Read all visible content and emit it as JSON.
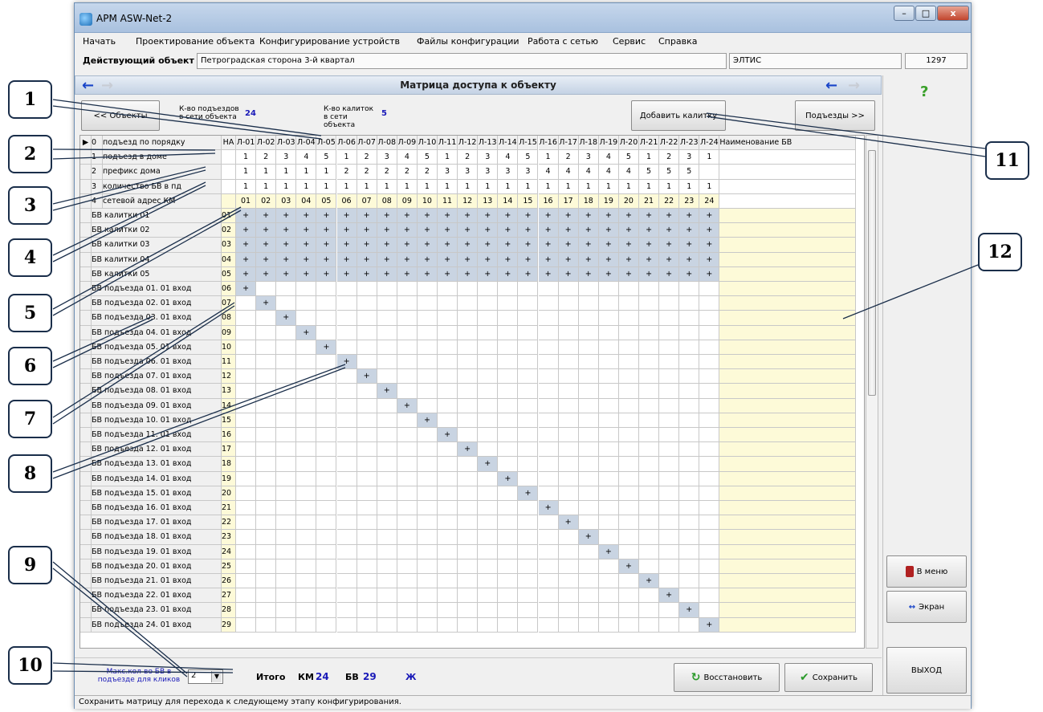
{
  "window": {
    "title": "АРМ ASW-Net-2",
    "btn_min": "–",
    "btn_max": "□",
    "btn_close": "x"
  },
  "menu": [
    "Начать",
    "Проектирование объекта",
    "Конфигурирование устройств",
    "Файлы конфигурации",
    "Работа с сетью",
    "Сервис",
    "Справка"
  ],
  "objectbar": {
    "label": "Действующий объект",
    "name": "Петроградская сторона 3-й квартал",
    "company": "ЭЛТИС",
    "code": "1297"
  },
  "header": {
    "title": "Матрица доступа к объекту"
  },
  "toolbar": {
    "back_button": "<< Объекты",
    "entrances_label": "К-во подъездов в сети объекта",
    "entrances_value": "24",
    "gates_label": "К-во калиток в сети объекта",
    "gates_value": "5",
    "add_gate_button": "Добавить калитку",
    "entrances_button": "Подъезды >>"
  },
  "grid": {
    "corner": "НА",
    "row_headers": [
      {
        "num": "0",
        "label": "подъезд по порядку"
      },
      {
        "num": "1",
        "label": "подъезд в доме"
      },
      {
        "num": "2",
        "label": "префикс дома"
      },
      {
        "num": "3",
        "label": "количество БВ в пд"
      },
      {
        "num": "4",
        "label": "сетевой адрес КМ"
      }
    ],
    "columns": [
      "Л-01",
      "Л-02",
      "Л-03",
      "Л-04",
      "Л-05",
      "Л-06",
      "Л-07",
      "Л-08",
      "Л-09",
      "Л-10",
      "Л-11",
      "Л-12",
      "Л-13",
      "Л-14",
      "Л-15",
      "Л-16",
      "Л-17",
      "Л-18",
      "Л-19",
      "Л-20",
      "Л-21",
      "Л-22",
      "Л-23",
      "Л-24"
    ],
    "name_column": "Наименование БВ",
    "entrance_in_house": [
      "1",
      "2",
      "3",
      "4",
      "5",
      "1",
      "2",
      "3",
      "4",
      "5",
      "1",
      "2",
      "3",
      "4",
      "5",
      "1",
      "2",
      "3",
      "4",
      "5",
      "1",
      "2",
      "3",
      "1"
    ],
    "house_prefix": [
      "1",
      "1",
      "1",
      "1",
      "1",
      "2",
      "2",
      "2",
      "2",
      "2",
      "3",
      "3",
      "3",
      "3",
      "3",
      "4",
      "4",
      "4",
      "4",
      "4",
      "5",
      "5",
      "5",
      ""
    ],
    "bv_count": [
      "1",
      "1",
      "1",
      "1",
      "1",
      "1",
      "1",
      "1",
      "1",
      "1",
      "1",
      "1",
      "1",
      "1",
      "1",
      "1",
      "1",
      "1",
      "1",
      "1",
      "1",
      "1",
      "1",
      "1"
    ],
    "network_address": [
      "01",
      "02",
      "03",
      "04",
      "05",
      "06",
      "07",
      "08",
      "09",
      "10",
      "11",
      "12",
      "13",
      "14",
      "15",
      "16",
      "17",
      "18",
      "19",
      "20",
      "21",
      "22",
      "23",
      "24"
    ],
    "mark": "+",
    "bv_rows": [
      {
        "name": "БВ калитки 01",
        "num": "01"
      },
      {
        "name": "БВ калитки 02",
        "num": "02"
      },
      {
        "name": "БВ калитки 03",
        "num": "03"
      },
      {
        "name": "БВ калитки 04",
        "num": "04"
      },
      {
        "name": "БВ калитки 05",
        "num": "05"
      },
      {
        "name": "БВ подъезда 01. 01 вход",
        "num": "06"
      },
      {
        "name": "БВ подъезда 02. 01 вход",
        "num": "07"
      },
      {
        "name": "БВ подъезда 03. 01 вход",
        "num": "08"
      },
      {
        "name": "БВ подъезда 04. 01 вход",
        "num": "09"
      },
      {
        "name": "БВ подъезда 05. 01 вход",
        "num": "10"
      },
      {
        "name": "БВ подъезда 06. 01 вход",
        "num": "11"
      },
      {
        "name": "БВ подъезда 07. 01 вход",
        "num": "12"
      },
      {
        "name": "БВ подъезда 08. 01 вход",
        "num": "13"
      },
      {
        "name": "БВ подъезда 09. 01 вход",
        "num": "14"
      },
      {
        "name": "БВ подъезда 10. 01 вход",
        "num": "15"
      },
      {
        "name": "БВ подъезда 11. 01 вход",
        "num": "16"
      },
      {
        "name": "БВ подъезда 12. 01 вход",
        "num": "17"
      },
      {
        "name": "БВ подъезда 13. 01 вход",
        "num": "18"
      },
      {
        "name": "БВ подъезда 14. 01 вход",
        "num": "19"
      },
      {
        "name": "БВ подъезда 15. 01 вход",
        "num": "20"
      },
      {
        "name": "БВ подъезда 16. 01 вход",
        "num": "21"
      },
      {
        "name": "БВ подъезда 17. 01 вход",
        "num": "22"
      },
      {
        "name": "БВ подъезда 18. 01 вход",
        "num": "23"
      },
      {
        "name": "БВ подъезда 19. 01 вход",
        "num": "24"
      },
      {
        "name": "БВ подъезда 20. 01 вход",
        "num": "25"
      },
      {
        "name": "БВ подъезда 21. 01 вход",
        "num": "26"
      },
      {
        "name": "БВ подъезда 22. 01 вход",
        "num": "27"
      },
      {
        "name": "БВ подъезда 23. 01 вход",
        "num": "28"
      },
      {
        "name": "БВ подъезда 24. 01 вход",
        "num": "29"
      }
    ]
  },
  "bottom": {
    "max_label": "Макс.кол-во БВ в подъезде для кликов",
    "max_value": "2",
    "total_label": "Итого",
    "km_label": "КМ",
    "km_value": "24",
    "bv_label": "БВ",
    "bv_value": "29",
    "bold_glyph": "Ж",
    "restore_button": "Восстановить",
    "save_button": "Сохранить"
  },
  "side": {
    "help": "?",
    "menu_button": "В меню",
    "screen_button": "Экран",
    "exit_button": "ВЫХОД"
  },
  "status": "Сохранить матрицу для перехода к следующему этапу конфигурирования.",
  "callouts": [
    "1",
    "2",
    "3",
    "4",
    "5",
    "6",
    "7",
    "8",
    "9",
    "10",
    "11",
    "12"
  ],
  "colors": {
    "gate_rows": "#c9d4e2",
    "name_column": "#fdfad8",
    "accent_blue": "#1844c8",
    "value_blue": "#1a1ab8"
  }
}
